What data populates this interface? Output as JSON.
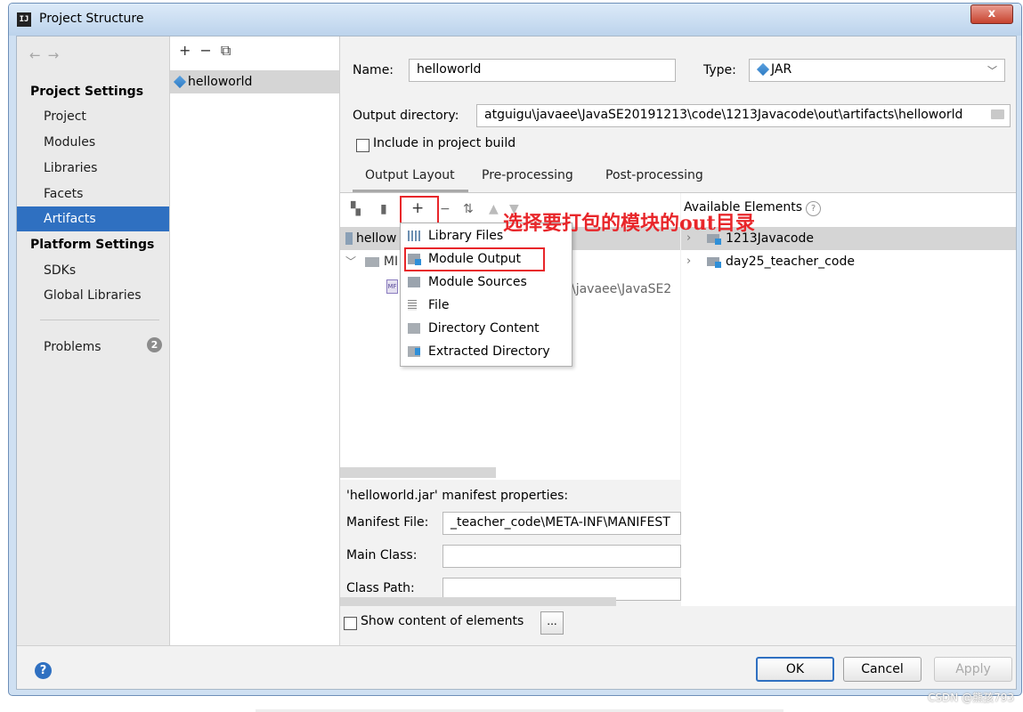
{
  "window": {
    "title": "Project Structure",
    "app_icon": "IJ",
    "close_label": "x"
  },
  "sidebar": {
    "project_settings_header": "Project Settings",
    "project_items": [
      "Project",
      "Modules",
      "Libraries",
      "Facets",
      "Artifacts"
    ],
    "selected": "Artifacts",
    "platform_settings_header": "Platform Settings",
    "platform_items": [
      "SDKs",
      "Global Libraries"
    ],
    "problems_label": "Problems",
    "problems_count": "2"
  },
  "artifacts_list": {
    "items": [
      "helloworld"
    ]
  },
  "artifact": {
    "name_label": "Name:",
    "name_value": "helloworld",
    "type_label": "Type:",
    "type_value": "JAR",
    "output_dir_label": "Output directory:",
    "output_dir_value": "atguigu\\javaee\\JavaSE20191213\\code\\1213Javacode\\out\\artifacts\\helloworld",
    "include_label": "Include in project build",
    "tabs": [
      "Output Layout",
      "Pre-processing",
      "Post-processing"
    ],
    "active_tab": "Output Layout"
  },
  "layout_tree": {
    "root": "hellow",
    "meta_folder": "MI",
    "path_fragment": "\\javaee\\JavaSE2"
  },
  "add_menu": {
    "items": [
      "Library Files",
      "Module Output",
      "Module Sources",
      "File",
      "Directory Content",
      "Extracted Directory"
    ],
    "highlighted": "Module Output"
  },
  "annotation": "选择要打包的模块的out目录",
  "available": {
    "title": "Available Elements",
    "help": "?",
    "items": [
      "1213Javacode",
      "day25_teacher_code"
    ]
  },
  "manifest": {
    "title": "'helloworld.jar' manifest properties:",
    "file_label": "Manifest File:",
    "file_value": "_teacher_code\\META-INF\\MANIFEST",
    "main_class_label": "Main Class:",
    "main_class_value": "",
    "class_path_label": "Class Path:",
    "class_path_value": ""
  },
  "show_content_label": "Show content of elements",
  "ellipsis_label": "...",
  "footer": {
    "help": "?",
    "ok": "OK",
    "cancel": "Cancel",
    "apply": "Apply"
  },
  "watermark": "CSDN @熊孩793"
}
